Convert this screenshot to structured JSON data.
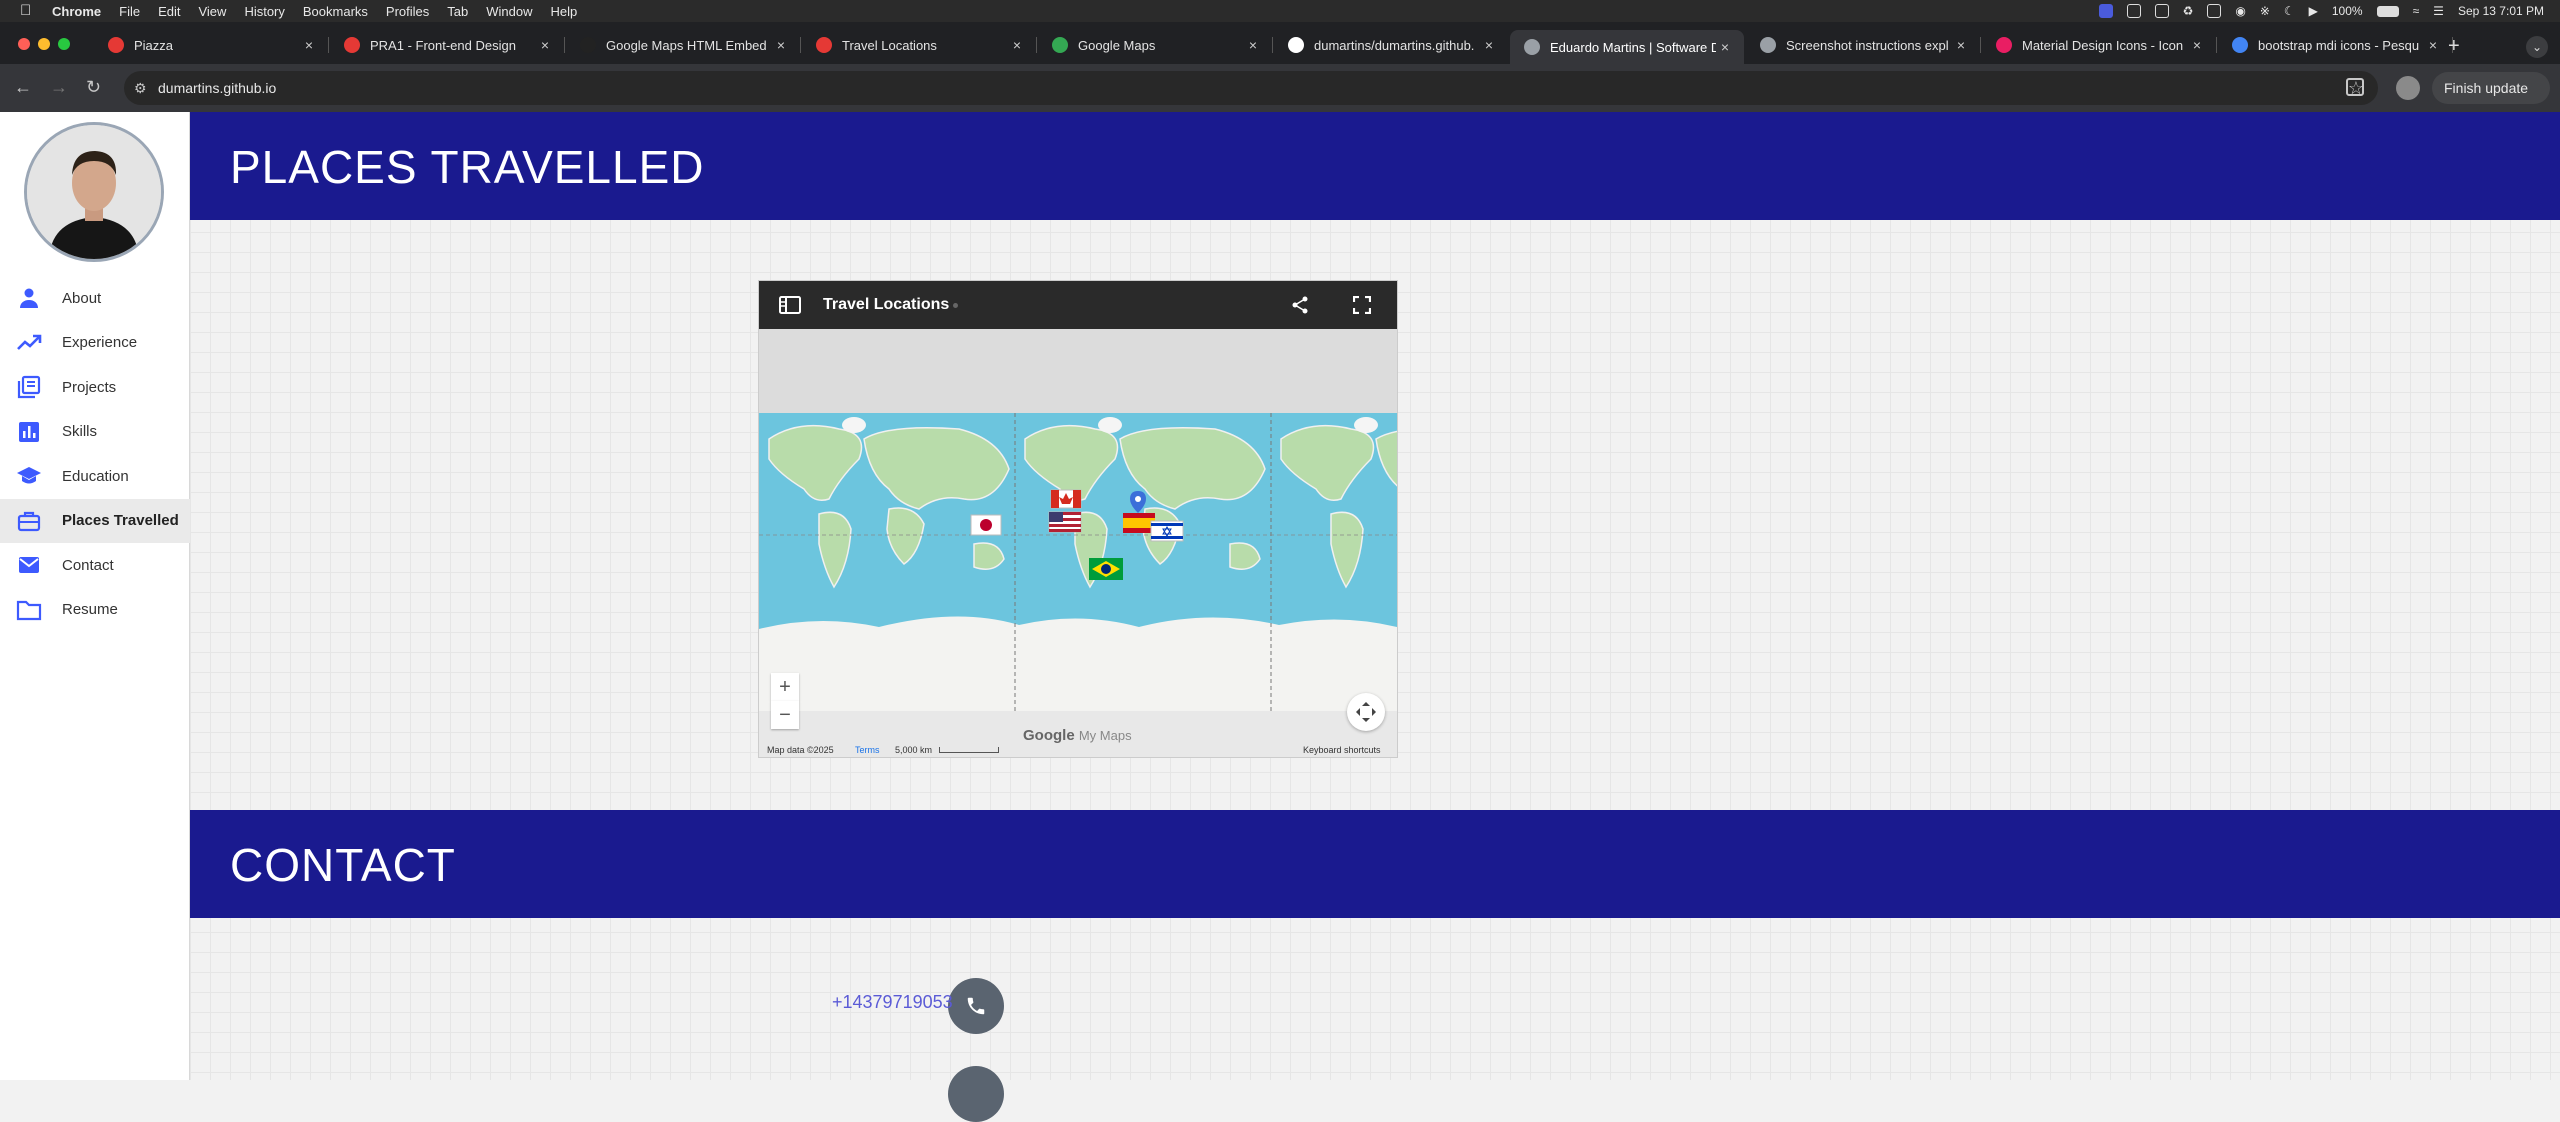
{
  "menubar": {
    "app": "Chrome",
    "items": [
      "File",
      "Edit",
      "View",
      "History",
      "Bookmarks",
      "Profiles",
      "Tab",
      "Window",
      "Help"
    ],
    "battery": "100%",
    "datetime": "Sep 13  7:01 PM"
  },
  "tabs": [
    {
      "title": "Piazza",
      "color": "#e53935"
    },
    {
      "title": "PRA1 - Front-end Design",
      "color": "#e53935"
    },
    {
      "title": "Google Maps HTML Embed",
      "color": "#222222"
    },
    {
      "title": "Travel Locations",
      "color": "#e53935"
    },
    {
      "title": "Google Maps",
      "color": "#34a853"
    },
    {
      "title": "dumartins/dumartins.github.",
      "color": "#ffffff"
    },
    {
      "title": "Eduardo Martins | Software D",
      "color": "#9aa0a6"
    },
    {
      "title": "Screenshot instructions expl",
      "color": "#9aa0a6"
    },
    {
      "title": "Material Design Icons - Icon",
      "color": "#e91e63"
    },
    {
      "title": "bootstrap mdi icons - Pesqu",
      "color": "#4285f4"
    }
  ],
  "toolbar": {
    "url": "dumartins.github.io",
    "finish_update": "Finish update"
  },
  "sidebar": {
    "items": [
      {
        "label": "About",
        "icon": "person-icon"
      },
      {
        "label": "Experience",
        "icon": "trending-up-icon"
      },
      {
        "label": "Projects",
        "icon": "library-books-icon"
      },
      {
        "label": "Skills",
        "icon": "bar-chart-icon"
      },
      {
        "label": "Education",
        "icon": "school-icon"
      },
      {
        "label": "Places Travelled",
        "icon": "briefcase-icon"
      },
      {
        "label": "Contact",
        "icon": "mail-icon"
      },
      {
        "label": "Resume",
        "icon": "folder-icon"
      }
    ],
    "active": "Places Travelled"
  },
  "sections": {
    "places_title": "PLACES TRAVELLED",
    "contact_title": "CONTACT"
  },
  "map": {
    "title": "Travel Locations",
    "footer": {
      "mapdata": "Map data ©2025",
      "terms": "Terms",
      "scale": "5,000 km",
      "shortcuts": "Keyboard shortcuts",
      "logo_google": "Google",
      "logo_mymaps": "My Maps"
    }
  },
  "contact": {
    "phone": "+14379719053"
  },
  "colors": {
    "banner": "#1a1a8f",
    "accent": "#3d5afe",
    "link": "#5b5bd6"
  }
}
